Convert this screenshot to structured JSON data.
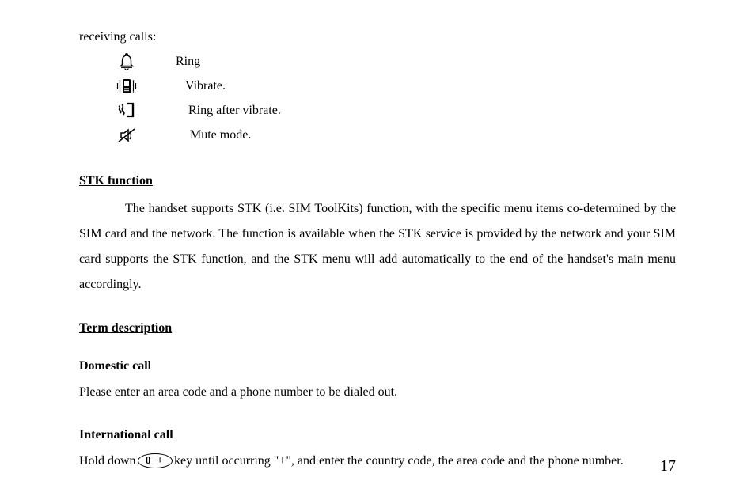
{
  "intro": "receiving calls:",
  "icons": {
    "ring": {
      "label": "Ring"
    },
    "vibrate": {
      "label": "Vibrate."
    },
    "ringAfterVibrate": {
      "label": "Ring after vibrate."
    },
    "mute": {
      "label": "Mute mode."
    }
  },
  "stk": {
    "heading": "STK function",
    "text": "The handset supports STK (i.e. SIM ToolKits) function, with the specific menu items co-determined by the SIM card and the network. The function is available when the STK service is provided by the network and your SIM card supports the STK function, and the STK menu will add automatically to the end of the handset's main menu accordingly."
  },
  "term": {
    "heading": "Term description"
  },
  "domestic": {
    "heading": "Domestic call",
    "text": "Please enter an area code and a phone number to be dialed out."
  },
  "international": {
    "heading": "International call",
    "prefix": "Hold down ",
    "keyLabel": "0 +",
    "suffix": " key until occurring \"+\", and enter the country code, the area code and the phone number."
  },
  "pageNumber": "17"
}
